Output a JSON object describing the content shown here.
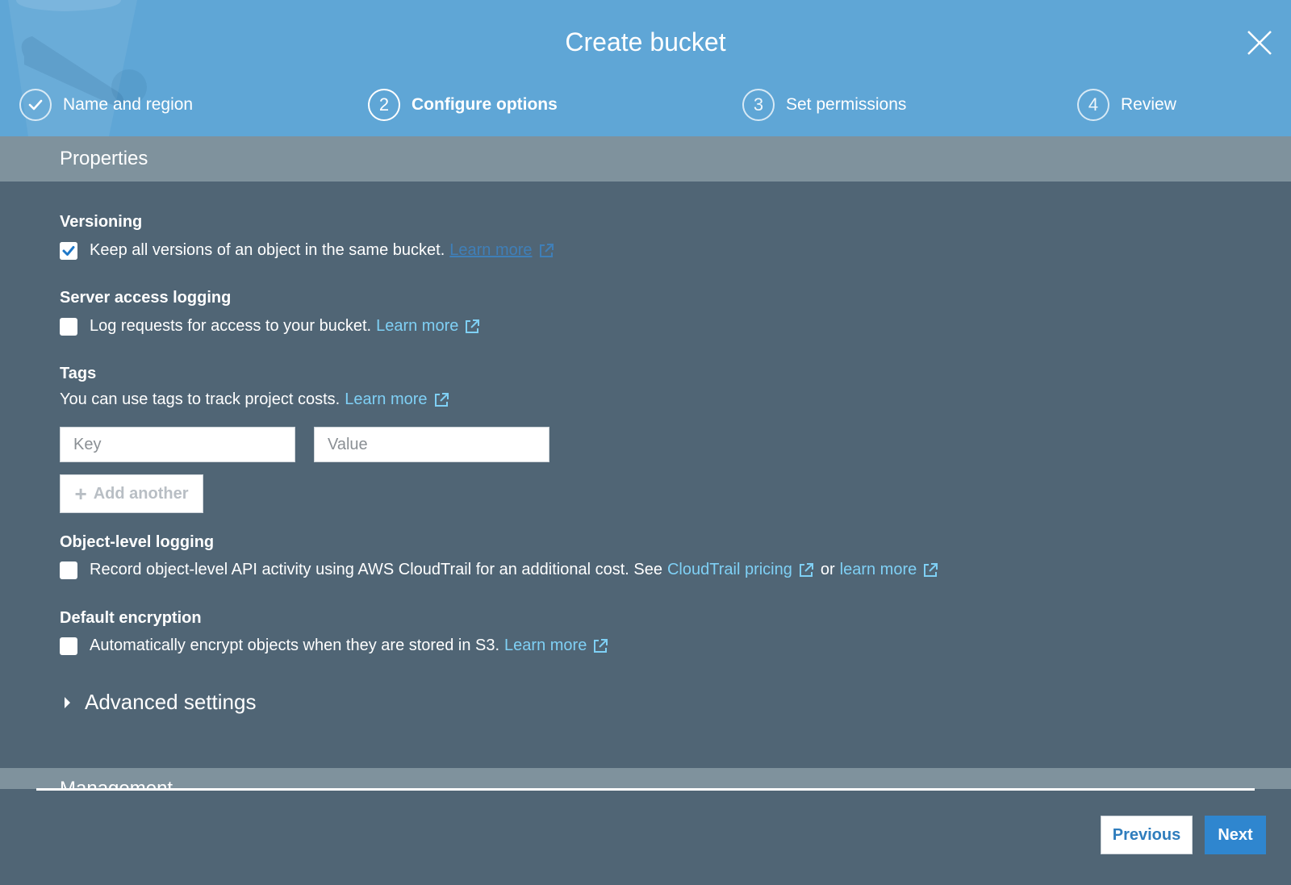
{
  "dialog": {
    "title": "Create bucket"
  },
  "steps": [
    {
      "number": "",
      "label": "Name and region",
      "state": "completed"
    },
    {
      "number": "2",
      "label": "Configure options",
      "state": "active"
    },
    {
      "number": "3",
      "label": "Set permissions",
      "state": "pending"
    },
    {
      "number": "4",
      "label": "Review",
      "state": "pending"
    }
  ],
  "properties": {
    "title": "Properties",
    "versioning": {
      "heading": "Versioning",
      "checked": true,
      "text": "Keep all versions of an object in the same bucket.",
      "link": "Learn more"
    },
    "server_access_logging": {
      "heading": "Server access logging",
      "checked": false,
      "text": "Log requests for access to your bucket.",
      "link": "Learn more"
    },
    "tags": {
      "heading": "Tags",
      "text": "You can use tags to track project costs.",
      "link": "Learn more",
      "key_placeholder": "Key",
      "value_placeholder": "Value",
      "add_label": "Add another"
    },
    "object_level_logging": {
      "heading": "Object-level logging",
      "checked": false,
      "text": "Record object-level API activity using AWS CloudTrail for an additional cost. See",
      "link1": "CloudTrail pricing",
      "or_text": "or",
      "link2": "learn more"
    },
    "default_encryption": {
      "heading": "Default encryption",
      "checked": false,
      "text": "Automatically encrypt objects when they are stored in S3.",
      "link": "Learn more"
    },
    "advanced": "Advanced settings"
  },
  "management": {
    "title": "Management"
  },
  "footer": {
    "previous": "Previous",
    "next": "Next"
  },
  "colors": {
    "header": "#5fa6d6",
    "body": "#506575",
    "section_bar": "#7f929d",
    "link": "#7fd0f5",
    "primary_button": "#2f86cf"
  }
}
